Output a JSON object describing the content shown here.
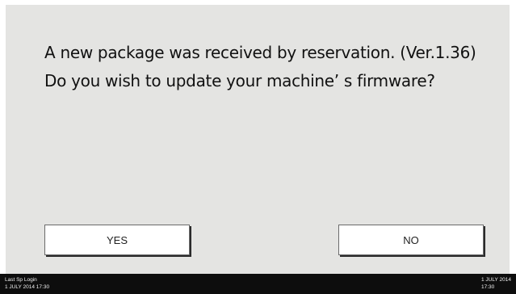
{
  "dialog": {
    "message_line_1": "A new package was received by reservation. (Ver.1.36)",
    "message_line_2": "Do you wish to update your machine’ s firmware?",
    "yes_label": "YES",
    "no_label": "NO"
  },
  "statusbar": {
    "last_login_label": "Last Sp Login",
    "last_login_datetime": "1 JULY  2014  17:30",
    "current_date": "1 JULY  2014",
    "current_time": "17:30"
  },
  "colors": {
    "panel_background": "#e4e4e2",
    "statusbar_background": "#0d0d0d",
    "button_background": "#ffffff"
  }
}
